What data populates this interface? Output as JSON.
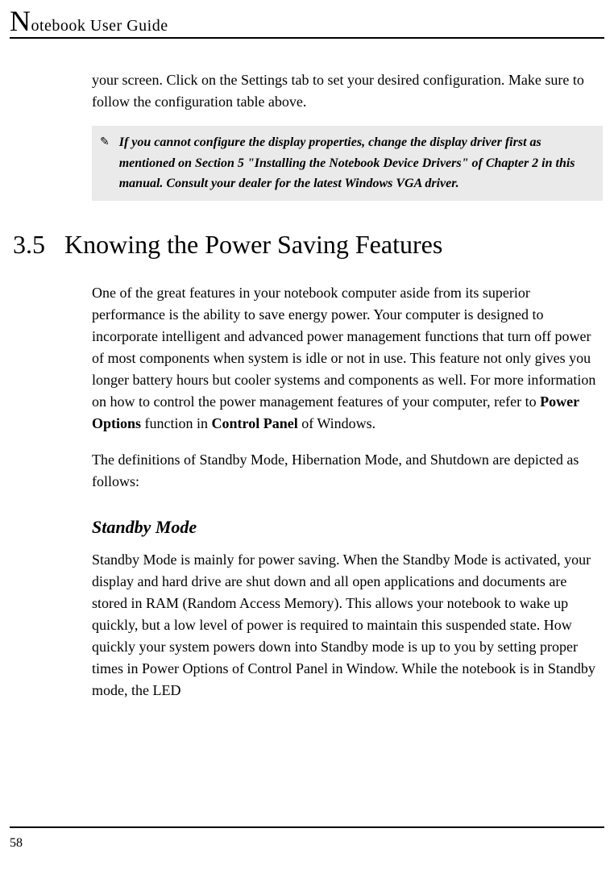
{
  "header": {
    "title_first_letter": "N",
    "title_rest": "otebook User Guide"
  },
  "intro_paragraph": "your screen. Click on the Settings tab to set your desired configuration. Make sure to follow the configuration table above.",
  "note": {
    "icon": "✎",
    "text": "If you cannot configure the display properties, change the display driver first as mentioned on Section 5 \"Installing the Notebook Device Drivers\" of Chapter 2 in this manual. Consult your dealer for the latest Windows VGA driver."
  },
  "section": {
    "number": "3.5",
    "title": "Knowing the Power Saving Features"
  },
  "paragraphs": {
    "p1_before_bold1": "One of the great features in your notebook computer aside from its superior performance is the ability to save energy power. Your computer is designed to incorporate intelligent and advanced power management functions that turn off power of most components when system is idle or not in use. This feature not only gives you longer battery hours but cooler systems and components as well. For more information on how to control the power management features of your computer, refer to ",
    "p1_bold1": "Power Options",
    "p1_mid": " function in ",
    "p1_bold2": "Control Panel",
    "p1_after": " of Windows.",
    "p2": "The definitions of Standby Mode, Hibernation Mode, and Shutdown are depicted as follows:"
  },
  "subsection": {
    "title": "Standby Mode",
    "body": "Standby Mode is mainly for power saving. When the Standby Mode is activated, your display and hard drive are shut down and all open applications and documents are stored in RAM (Random Access Memory). This allows your notebook to wake up quickly, but a low level of power is required to maintain this suspended state. How quickly your system powers down into Standby mode is up to you by setting proper times in Power Options of Control Panel in Window. While the notebook is in Standby mode, the LED"
  },
  "footer": {
    "page_number": "58"
  }
}
